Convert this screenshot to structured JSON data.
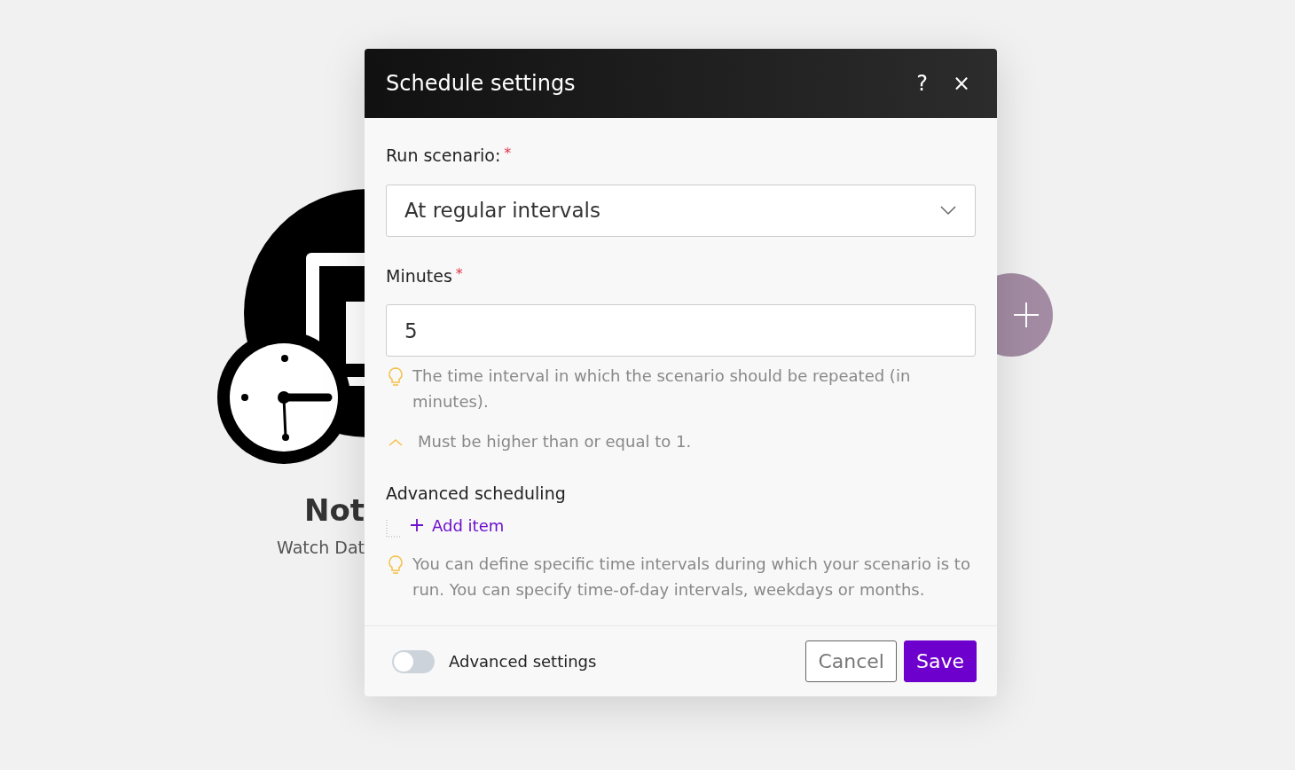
{
  "canvas": {
    "module": {
      "title": "Not",
      "subtitle": "Watch Dat"
    }
  },
  "dialog": {
    "title": "Schedule settings",
    "help": "?",
    "close": "×",
    "fields": [
      {
        "kind": "select",
        "label": "Run scenario:",
        "required_mark": "*",
        "value": "At regular intervals"
      },
      {
        "kind": "text",
        "label": "Minutes",
        "required_mark": "*",
        "value": "5",
        "hints": [
          {
            "kind": "tip",
            "text": "The time interval in which the scenario should be repeated (in minutes)."
          },
          {
            "kind": "rule",
            "text": "Must be higher than or equal to 1."
          }
        ]
      }
    ],
    "advanced_scheduling": {
      "label": "Advanced scheduling",
      "add": "Add item",
      "hint": "You can define specific time intervals during which your scenario is to run. You can specify time-of-day intervals, weekdays or months."
    },
    "footer": {
      "toggle": {
        "label": "Advanced settings",
        "on": false
      },
      "buttons": [
        {
          "kind": "secondary",
          "label": "Cancel"
        },
        {
          "kind": "primary",
          "label": "Save"
        }
      ]
    }
  }
}
